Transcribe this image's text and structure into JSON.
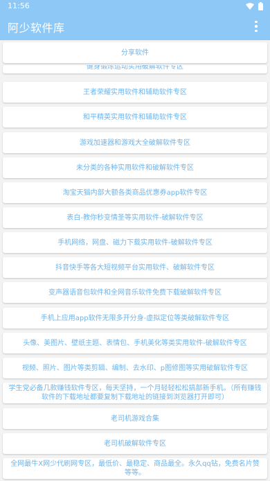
{
  "status_bar": {
    "time": "11:56",
    "icons": [
      "wifi-icon",
      "battery-icon"
    ]
  },
  "app_bar": {
    "title": "阿少软件库",
    "menu_icon": "more-vert-icon"
  },
  "colors": {
    "app_bar": "#8ec8f6",
    "item_text": "#6fb4ea",
    "background": "#f3f3f3",
    "card": "#ffffff"
  },
  "items": [
    "分享软件",
    "健身锻炼运动实用破解软件专区",
    "王者荣耀实用软件和辅助软件专区",
    "和平精英实用软件和辅助软件专区",
    "游戏加速器和游戏大全破解软件专区",
    "未分类的各种实用软件和破解软件专区",
    "淘宝天猫内部大额各类商品优惠券app软件专区",
    "表白-教你秒变情圣等实用软件-破解软件专区",
    "手机网络，网盘、磁力下载实用软件-破解软件专区",
    "抖音快手等各大短视频平台实用软件、破解软件专区",
    "变声器语音包软件和全网音乐软件免费下载破解软件专区",
    "手机上应用app软件无限多开分身-虚拟定位等类破解软件专区",
    "头像、美图片、壁纸主题、表情包、手机美化等类实用软件-破解软件专区",
    "视频、照片、图片等类剪辑、编制、去水印、p图修图等实用破解软件专区",
    "学生党必备几款赚钱软件专区，每天坚持，一个月轻轻松松搞部新手机。（所有赚钱软件的下载地址都要复制下载地址的链接到浏览器打开即可）",
    "老司机游戏合集",
    "老司机破解软件专区",
    "全网最牛X网少代刷网专区，最低价、最稳定、商品最全。永久qq钻，免费名片赞等等。"
  ]
}
